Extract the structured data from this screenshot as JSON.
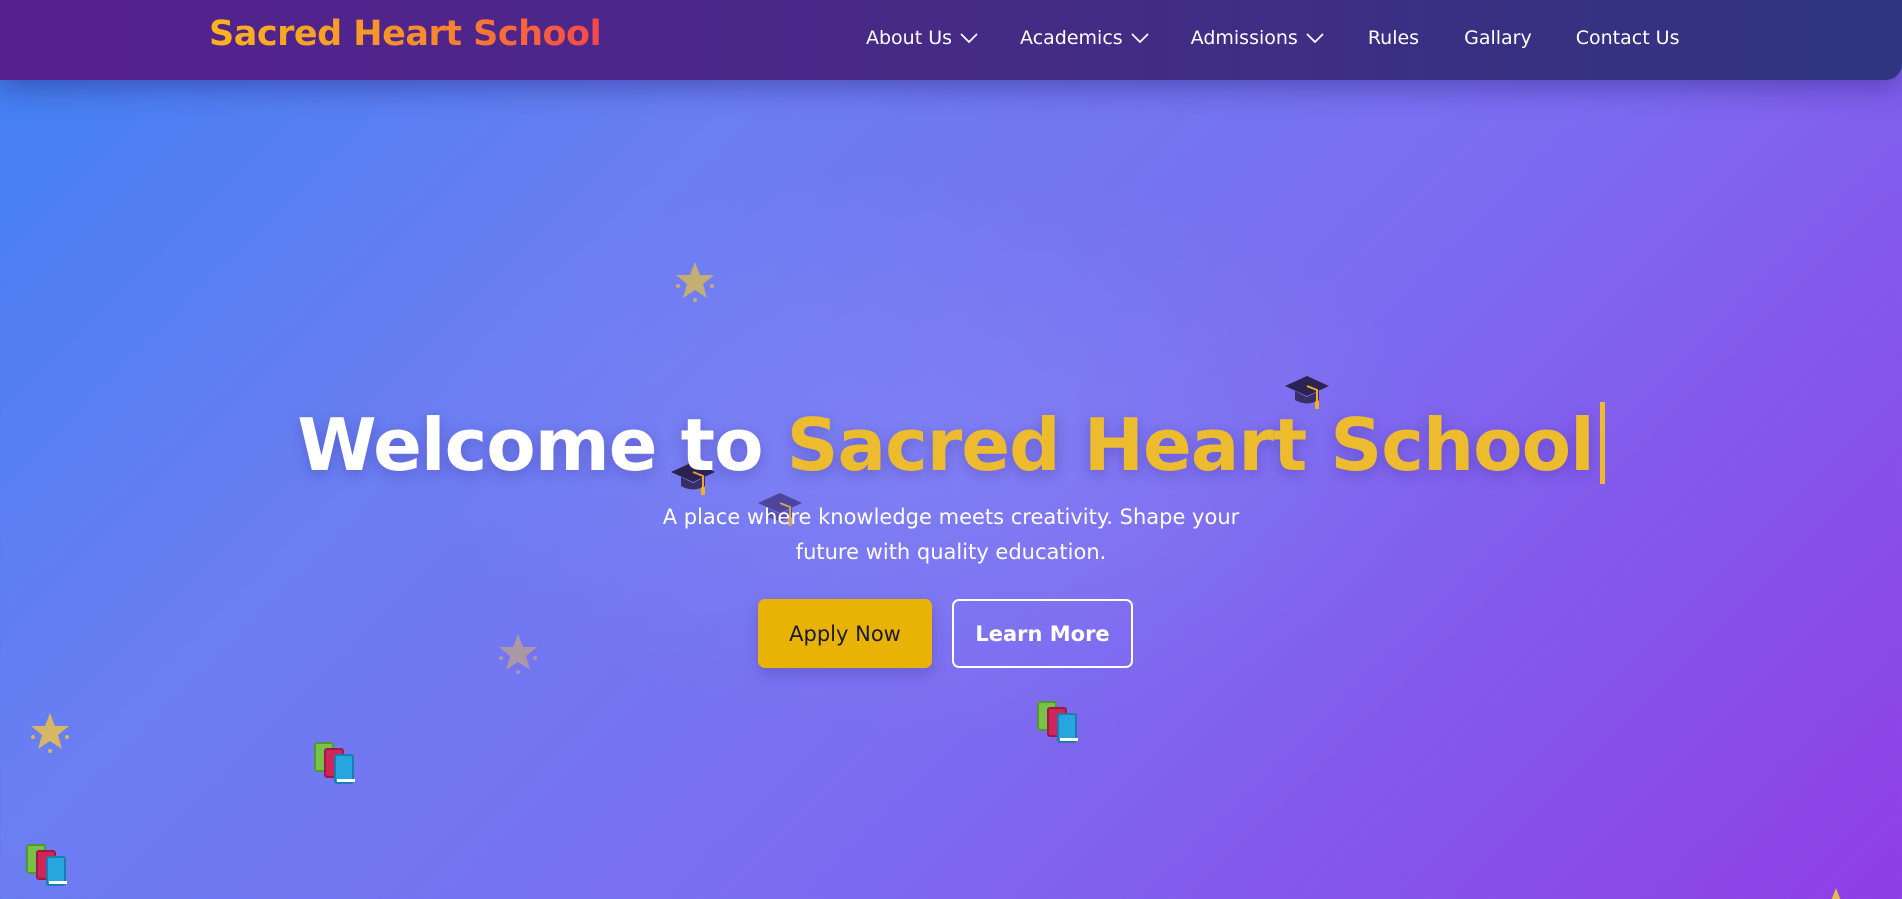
{
  "nav": {
    "brand": "Sacred Heart School",
    "items": [
      {
        "label": "About Us",
        "has_dropdown": true
      },
      {
        "label": "Academics",
        "has_dropdown": true
      },
      {
        "label": "Admissions",
        "has_dropdown": true
      },
      {
        "label": "Rules",
        "has_dropdown": false
      },
      {
        "label": "Gallary",
        "has_dropdown": false
      },
      {
        "label": "Contact Us",
        "has_dropdown": false
      }
    ]
  },
  "hero": {
    "title_prefix": "Welcome to ",
    "title_highlight": "Sacred Heart School",
    "subtitle": "A place where knowledge meets creativity. Shape your future with quality education.",
    "primary_button": "Apply Now",
    "secondary_button": "Learn More"
  },
  "decorations": {
    "stars": "star-icon",
    "caps": "graduation-cap-icon",
    "books": "books-icon"
  },
  "colors": {
    "brand_gradient_start": "#f8b51d",
    "brand_gradient_end": "#f4474a",
    "accent": "#ecbc2e",
    "primary_button": "#e9b305",
    "nav_start": "#56208f",
    "nav_end": "#2f3580"
  }
}
